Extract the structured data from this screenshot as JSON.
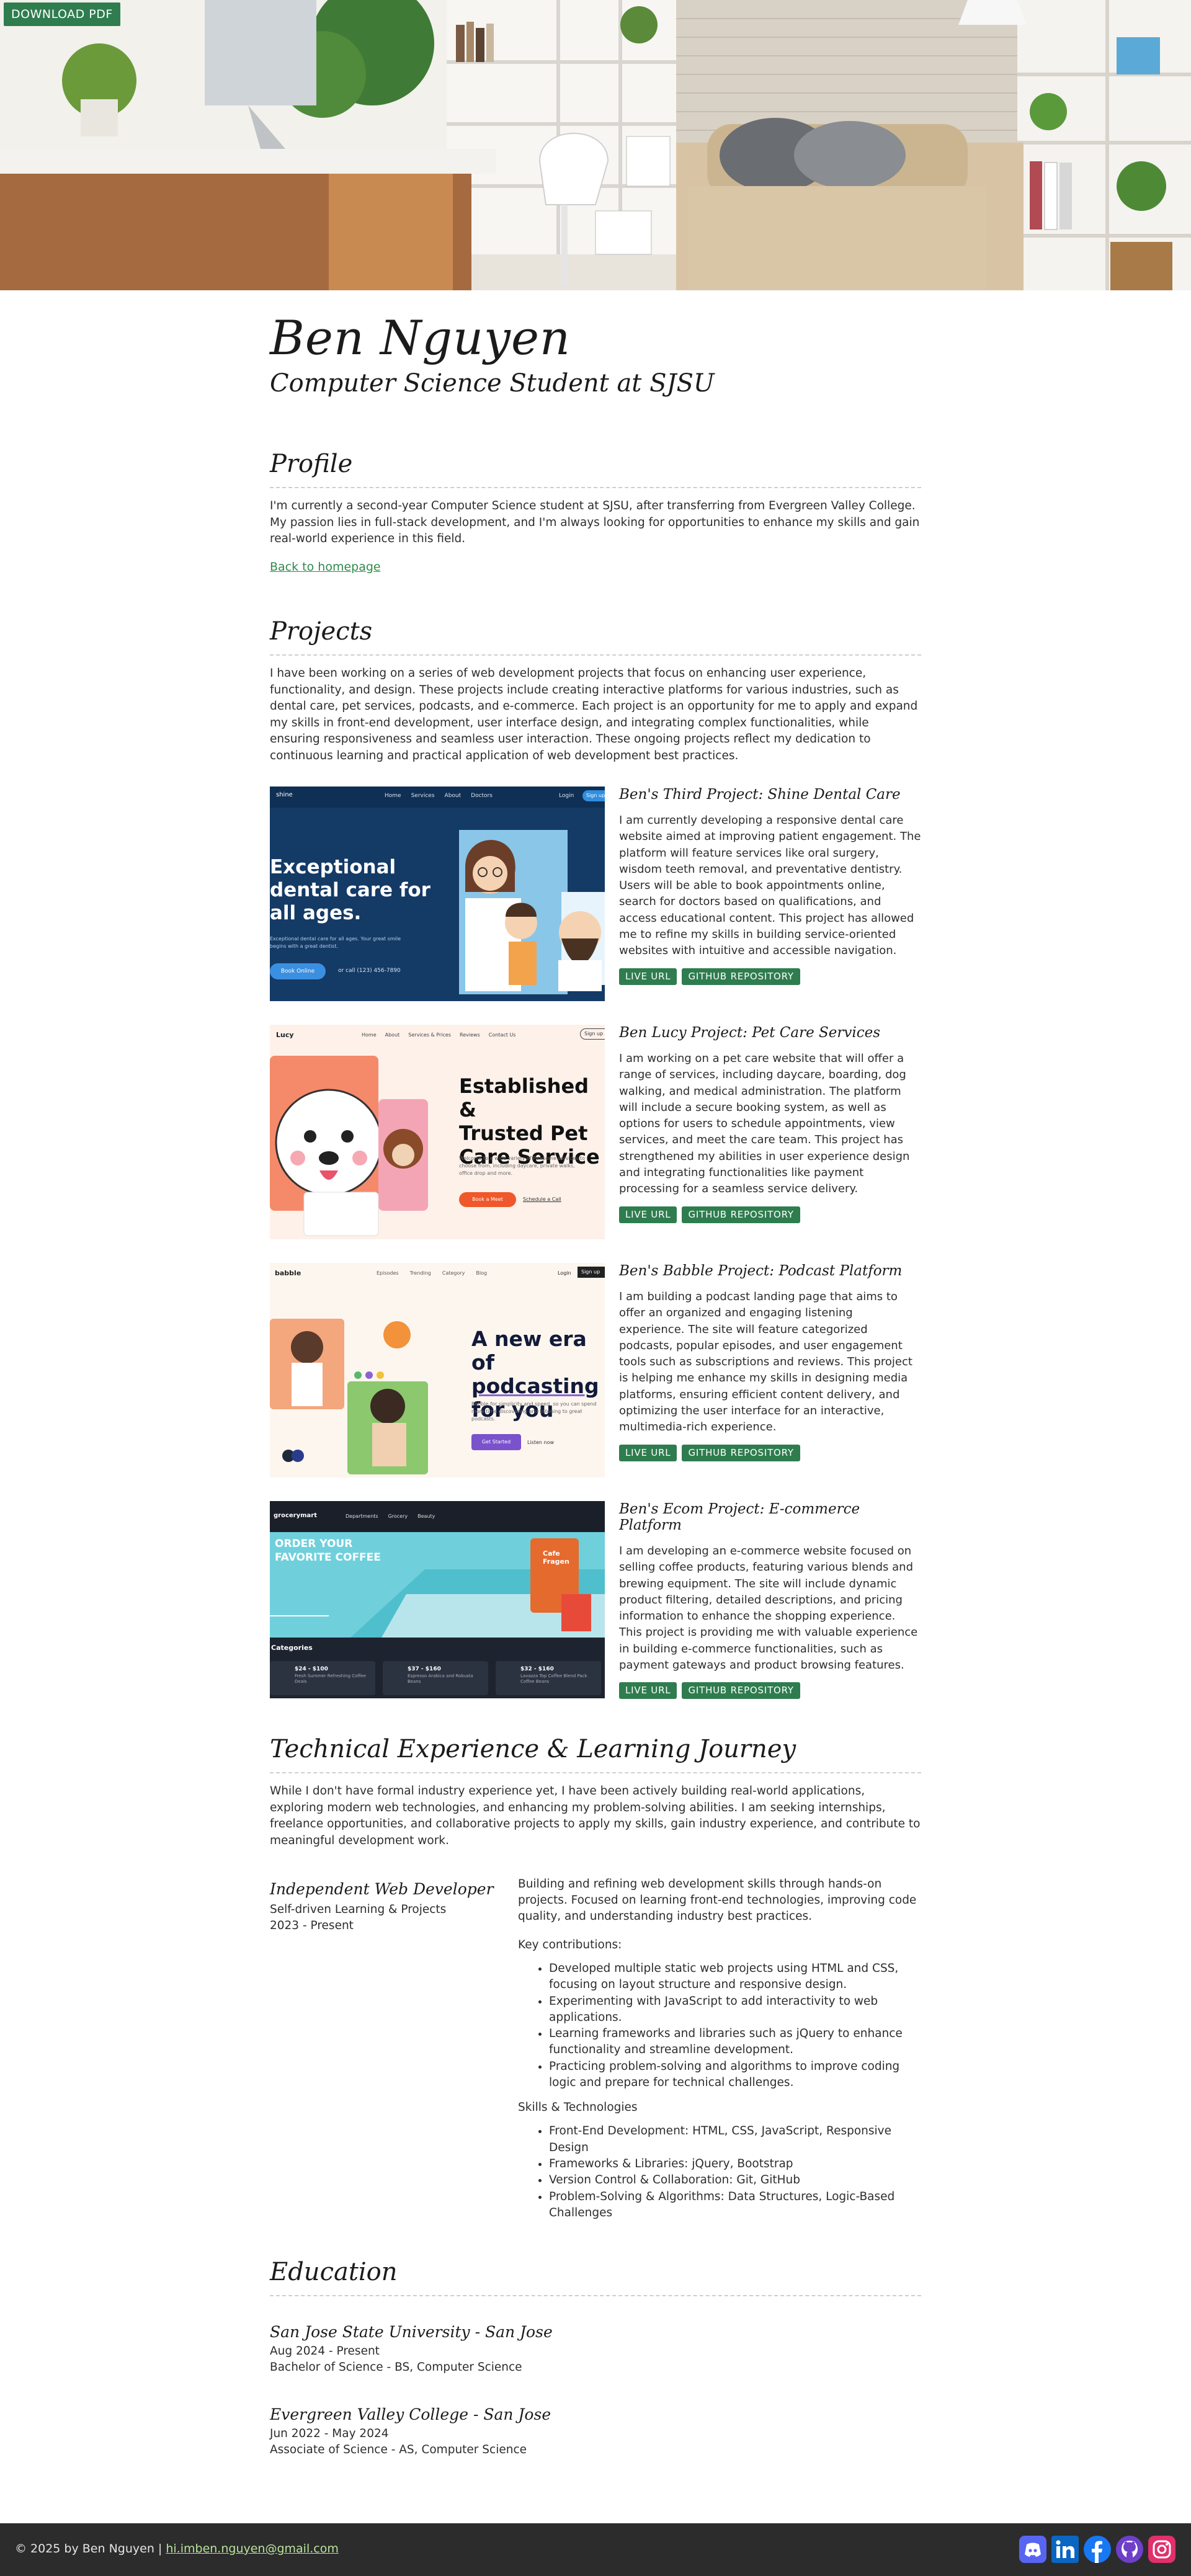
{
  "hero": {
    "download_label": "DOWNLOAD PDF"
  },
  "header": {
    "name": "Ben Nguyen",
    "subtitle": "Computer Science Student at SJSU"
  },
  "profile": {
    "title": "Profile",
    "text": "I'm currently a second-year Computer Science student at SJSU, after transferring from Evergreen Valley College. My passion lies in full-stack development, and I'm always looking for opportunities to enhance my skills and gain real-world experience in this field.",
    "back_link": "Back to homepage"
  },
  "projects": {
    "title": "Projects",
    "intro": "I have been working on a series of web development projects that focus on enhancing user experience, functionality, and design. These projects include creating interactive platforms for various industries, such as dental care, pet services, podcasts, and e-commerce. Each project is an opportunity for me to apply and expand my skills in front-end development, user interface design, and integrating complex functionalities, while ensuring responsiveness and seamless user interaction. These ongoing projects reflect my dedication to continuous learning and practical application of web development best practices.",
    "live_label": "LIVE URL",
    "repo_label": "GITHUB REPOSITORY",
    "items": [
      {
        "title": "Ben's Third Project: Shine Dental Care",
        "desc": "I am currently developing a responsive dental care website aimed at improving patient engagement. The platform will feature services like oral surgery, wisdom teeth removal, and preventative dentistry. Users will be able to book appointments online, search for doctors based on qualifications, and access educational content. This project has allowed me to refine my skills in building service-oriented websites with intuitive and accessible navigation.",
        "thumb": {
          "nav_logo": "shine",
          "nav": [
            "Home",
            "Services",
            "About",
            "Doctors"
          ],
          "login": "Login",
          "cta": "Sign up",
          "headline": [
            "Exceptional",
            "dental care for",
            "all ages."
          ],
          "sub": "Exceptional dental care for all ages. Your great smile begins with a great dentist.",
          "button": "Book Online",
          "phone": "or call (123) 456-7890"
        }
      },
      {
        "title": "Ben Lucy Project: Pet Care Services",
        "desc": "I am working on a pet care website that will offer a range of services, including daycare, boarding, dog walking, and medical administration. The platform will include a secure booking system, as well as options for users to schedule appointments, view services, and meet the care team. This project has strengthened my abilities in user experience design and integrating functionalities like payment processing for a seamless service delivery.",
        "thumb": {
          "logo": "Lucy",
          "nav": [
            "Home",
            "About",
            "Services & Prices",
            "Reviews",
            "Contact Us"
          ],
          "signup": "Sign up",
          "headline": [
            "Established &",
            "Trusted Pet",
            "Care Service"
          ],
          "sub": "Welcome to a wide variety of Pawsome services to choose from, including daycare, private walks, office drop and more.",
          "button": "Book a Meet",
          "button2": "Schedule a Call"
        }
      },
      {
        "title": "Ben's Babble Project: Podcast Platform",
        "desc": "I am building a podcast landing page that aims to offer an organized and engaging listening experience. The site will feature categorized podcasts, popular episodes, and user engagement tools such as subscriptions and reviews. This project is helping me enhance my skills in designing media platforms, ensuring efficient content delivery, and optimizing the user interface for an interactive, multimedia-rich experience.",
        "thumb": {
          "logo": "babble",
          "nav": [
            "Episodes",
            "Trending",
            "Category",
            "Blog"
          ],
          "login": "Login",
          "signup": "Sign up",
          "headline": [
            "A new era of",
            "podcasting",
            "for you"
          ],
          "sub": "Babble for simplicity and speed, so you can spend more time discovering and listening to great podcasts.",
          "button": "Get Started",
          "button2": "Listen now"
        }
      },
      {
        "title": "Ben's Ecom Project: E-commerce Platform",
        "desc": "I am developing an e-commerce website focused on selling coffee products, featuring various blends and brewing equipment. The site will include dynamic product filtering, detailed descriptions, and pricing information to enhance the shopping experience. This project is providing me with valuable experience in building e-commerce functionalities, such as payment gateways and product browsing features.",
        "thumb": {
          "logo": "grocerymart",
          "nav": [
            "Departments",
            "Grocery",
            "Beauty"
          ],
          "headline": [
            "ORDER YOUR",
            "FAVORITE COFFEE"
          ],
          "bag": [
            "Cafe",
            "Fragen"
          ],
          "categories_title": "Categories",
          "cards": [
            {
              "price": "$24 - $100",
              "label": "Fresh Summer Refreshing Coffee Deals"
            },
            {
              "price": "$37 - $160",
              "label": "Espresso Arabica and Robusta Beans"
            },
            {
              "price": "$32 - $160",
              "label": "Lavazza Top Coffee Blend Pack Coffee Beans"
            }
          ]
        }
      }
    ]
  },
  "experience": {
    "title": "Technical Experience & Learning Journey",
    "intro": "While I don't have formal industry experience yet, I have been actively building real-world applications, exploring modern web technologies, and enhancing my problem-solving abilities. I am seeking internships, freelance opportunities, and collaborative projects to apply my skills, gain industry experience, and contribute to meaningful development work.",
    "role": "Independent Web Developer",
    "org": "Self-driven Learning & Projects",
    "dates": "2023 - Present",
    "summary": "Building and refining web development skills through hands-on projects. Focused on learning front-end technologies, improving code quality, and understanding industry best practices.",
    "contrib_label": "Key contributions:",
    "contributions": [
      "Developed multiple static web projects using HTML and CSS, focusing on layout structure and responsive design.",
      "Experimenting with JavaScript to add interactivity to web applications.",
      "Learning frameworks and libraries such as jQuery to enhance functionality and streamline development.",
      "Practicing problem-solving and algorithms to improve coding logic and prepare for technical challenges."
    ],
    "skills_label": "Skills & Technologies",
    "skills": [
      "Front-End Development: HTML, CSS, JavaScript, Responsive Design",
      "Frameworks & Libraries: jQuery, Bootstrap",
      "Version Control & Collaboration: Git, GitHub",
      "Problem-Solving & Algorithms: Data Structures, Logic-Based Challenges"
    ]
  },
  "education": {
    "title": "Education",
    "items": [
      {
        "school": "San Jose State University - San Jose",
        "dates": "Aug 2024 - Present",
        "degree": "Bachelor of Science - BS, Computer Science"
      },
      {
        "school": "Evergreen Valley College - San Jose",
        "dates": "Jun 2022 - May 2024",
        "degree": "Associate of Science - AS, Computer Science"
      }
    ]
  },
  "footer": {
    "copy": "© 2025 by Ben Nguyen | ",
    "email": "hi.imben.nguyen@gmail.com",
    "social": [
      {
        "name": "discord-icon",
        "color": "#5865f2"
      },
      {
        "name": "linkedin-icon",
        "color": "#0a66c2"
      },
      {
        "name": "facebook-icon",
        "color": "#1877f2"
      },
      {
        "name": "github-icon",
        "color": "#6e40c9"
      },
      {
        "name": "instagram-icon",
        "color": "#e1306c"
      }
    ]
  }
}
